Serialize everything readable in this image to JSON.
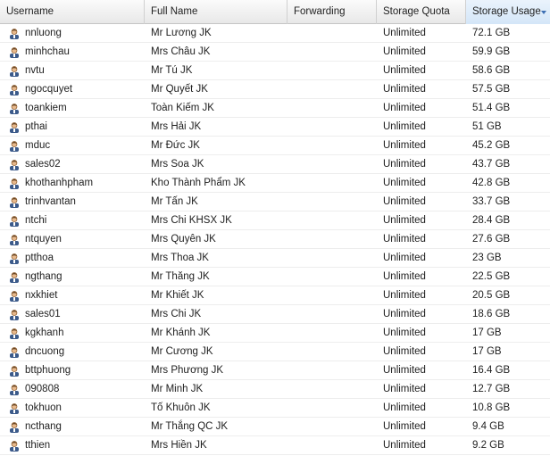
{
  "columns": {
    "username": "Username",
    "full_name": "Full Name",
    "forwarding": "Forwarding",
    "storage_quota": "Storage Quota",
    "storage_usage": "Storage Usage"
  },
  "sorted_column": "storage_usage",
  "sort_direction": "descending",
  "icons": {
    "user": "user-icon",
    "sort": "sort-descending-icon"
  },
  "colors": {
    "header_sorted": "#d4e6f8",
    "sort_arrow": "#3d6fb3"
  },
  "rows": [
    {
      "username": "nnluong",
      "full_name": "Mr Lương JK",
      "forwarding": "",
      "quota": "Unlimited",
      "usage": "72.1 GB"
    },
    {
      "username": "minhchau",
      "full_name": "Mrs Châu JK",
      "forwarding": "",
      "quota": "Unlimited",
      "usage": "59.9 GB"
    },
    {
      "username": "nvtu",
      "full_name": "Mr Tú JK",
      "forwarding": "",
      "quota": "Unlimited",
      "usage": "58.6 GB"
    },
    {
      "username": "ngocquyet",
      "full_name": "Mr Quyết JK",
      "forwarding": "",
      "quota": "Unlimited",
      "usage": "57.5 GB"
    },
    {
      "username": "toankiem",
      "full_name": "Toàn Kiếm JK",
      "forwarding": "",
      "quota": "Unlimited",
      "usage": "51.4 GB"
    },
    {
      "username": "pthai",
      "full_name": "Mrs Hải JK",
      "forwarding": "",
      "quota": "Unlimited",
      "usage": "51 GB"
    },
    {
      "username": "mduc",
      "full_name": "Mr Đức JK",
      "forwarding": "",
      "quota": "Unlimited",
      "usage": "45.2 GB"
    },
    {
      "username": "sales02",
      "full_name": "Mrs Soa JK",
      "forwarding": "",
      "quota": "Unlimited",
      "usage": "43.7 GB"
    },
    {
      "username": "khothanhpham",
      "full_name": "Kho Thành Phẩm JK",
      "forwarding": "",
      "quota": "Unlimited",
      "usage": "42.8 GB"
    },
    {
      "username": "trinhvantan",
      "full_name": "Mr Tấn JK",
      "forwarding": "",
      "quota": "Unlimited",
      "usage": "33.7 GB"
    },
    {
      "username": "ntchi",
      "full_name": "Mrs Chi KHSX JK",
      "forwarding": "",
      "quota": "Unlimited",
      "usage": "28.4 GB"
    },
    {
      "username": "ntquyen",
      "full_name": "Mrs Quyên JK",
      "forwarding": "",
      "quota": "Unlimited",
      "usage": "27.6 GB"
    },
    {
      "username": "ptthoa",
      "full_name": "Mrs Thoa JK",
      "forwarding": "",
      "quota": "Unlimited",
      "usage": "23 GB"
    },
    {
      "username": "ngthang",
      "full_name": "Mr Thăng JK",
      "forwarding": "",
      "quota": "Unlimited",
      "usage": "22.5 GB"
    },
    {
      "username": "nxkhiet",
      "full_name": "Mr Khiết JK",
      "forwarding": "",
      "quota": "Unlimited",
      "usage": "20.5 GB"
    },
    {
      "username": "sales01",
      "full_name": "Mrs Chi JK",
      "forwarding": "",
      "quota": "Unlimited",
      "usage": "18.6 GB"
    },
    {
      "username": "kgkhanh",
      "full_name": "Mr Khánh JK",
      "forwarding": "",
      "quota": "Unlimited",
      "usage": "17 GB"
    },
    {
      "username": "dncuong",
      "full_name": "Mr Cương JK",
      "forwarding": "",
      "quota": "Unlimited",
      "usage": "17 GB"
    },
    {
      "username": "bttphuong",
      "full_name": "Mrs Phương JK",
      "forwarding": "",
      "quota": "Unlimited",
      "usage": "16.4 GB"
    },
    {
      "username": "090808",
      "full_name": "Mr Minh JK",
      "forwarding": "",
      "quota": "Unlimited",
      "usage": "12.7 GB"
    },
    {
      "username": "tokhuon",
      "full_name": "Tố Khuôn JK",
      "forwarding": "",
      "quota": "Unlimited",
      "usage": "10.8 GB"
    },
    {
      "username": "ncthang",
      "full_name": "Mr Thắng QC JK",
      "forwarding": "",
      "quota": "Unlimited",
      "usage": "9.4 GB"
    },
    {
      "username": "tthien",
      "full_name": "Mrs Hiền JK",
      "forwarding": "",
      "quota": "Unlimited",
      "usage": "9.2 GB"
    }
  ]
}
